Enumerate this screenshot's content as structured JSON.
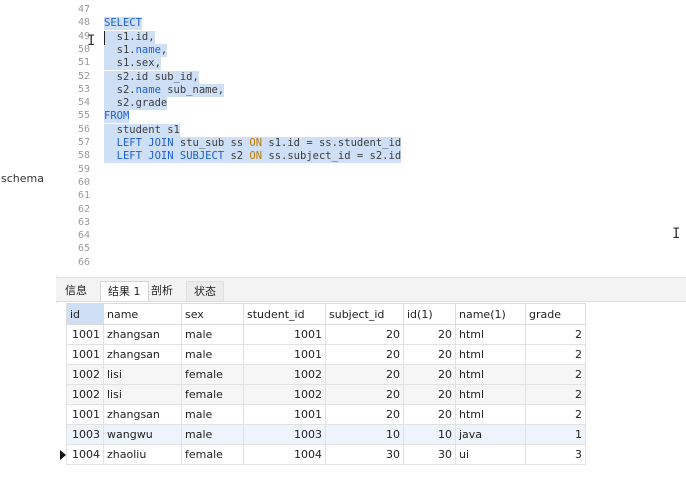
{
  "sidebar": {
    "label": "schema"
  },
  "editor": {
    "lines": [
      {
        "num": "47",
        "text": "",
        "sel": false
      },
      {
        "num": "48",
        "kw": "SELECT",
        "text": "",
        "sel": true
      },
      {
        "num": "49",
        "text": "  s1.id,",
        "sel": true
      },
      {
        "num": "50",
        "text": "  s1.",
        "kw": "name",
        "tail": ",",
        "sel": true
      },
      {
        "num": "51",
        "text": "  s1.sex,",
        "sel": true
      },
      {
        "num": "52",
        "text": "  s2.id sub_id,",
        "sel": true
      },
      {
        "num": "53",
        "text": "  s2.",
        "kw": "name",
        "tail": " sub_name,",
        "sel": true
      },
      {
        "num": "54",
        "text": "  s2.grade",
        "sel": true
      },
      {
        "num": "55",
        "kw": "FROM",
        "text": "",
        "sel": true
      },
      {
        "num": "56",
        "text": "  student s1",
        "sel": true
      },
      {
        "num": "57",
        "text": "",
        "sel": true
      },
      {
        "num": "58",
        "text": "",
        "sel": true
      },
      {
        "num": "59",
        "text": "",
        "sel": false
      },
      {
        "num": "60",
        "text": "",
        "sel": false
      },
      {
        "num": "61",
        "text": "",
        "sel": false
      },
      {
        "num": "62",
        "text": "",
        "sel": false
      },
      {
        "num": "63",
        "text": "",
        "sel": false
      },
      {
        "num": "64",
        "text": "",
        "sel": false
      },
      {
        "num": "65",
        "text": "",
        "sel": false
      },
      {
        "num": "66",
        "text": "",
        "sel": false
      }
    ],
    "join1": {
      "kw1": "LEFT JOIN",
      "mid": " stu_sub ss ",
      "kw2": "ON",
      "tail": " s1.id = ss.student_id"
    },
    "join2": {
      "kw1": "LEFT JOIN SUBJECT",
      "mid": " s2 ",
      "kw2": "ON",
      "tail": " ss.subject_id = s2.id"
    }
  },
  "tabs": [
    "信息",
    "结果 1",
    "剖析",
    "状态"
  ],
  "grid": {
    "columns": [
      "id",
      "name",
      "sex",
      "student_id",
      "subject_id",
      "id(1)",
      "name(1)",
      "grade"
    ],
    "rows": [
      [
        "1001",
        "zhangsan",
        "male",
        "1001",
        "20",
        "20",
        "html",
        "2"
      ],
      [
        "1001",
        "zhangsan",
        "male",
        "1001",
        "20",
        "20",
        "html",
        "2"
      ],
      [
        "1002",
        "lisi",
        "female",
        "1002",
        "20",
        "20",
        "html",
        "2"
      ],
      [
        "1002",
        "lisi",
        "female",
        "1002",
        "20",
        "20",
        "html",
        "2"
      ],
      [
        "1001",
        "zhangsan",
        "male",
        "1001",
        "20",
        "20",
        "html",
        "2"
      ],
      [
        "1003",
        "wangwu",
        "male",
        "1003",
        "10",
        "10",
        "java",
        "1"
      ],
      [
        "1004",
        "zhaoliu",
        "female",
        "1004",
        "30",
        "30",
        "ui",
        "3"
      ]
    ]
  },
  "colors": {
    "keyword": "#1a5fd6",
    "selection": "#cfe0f6"
  }
}
